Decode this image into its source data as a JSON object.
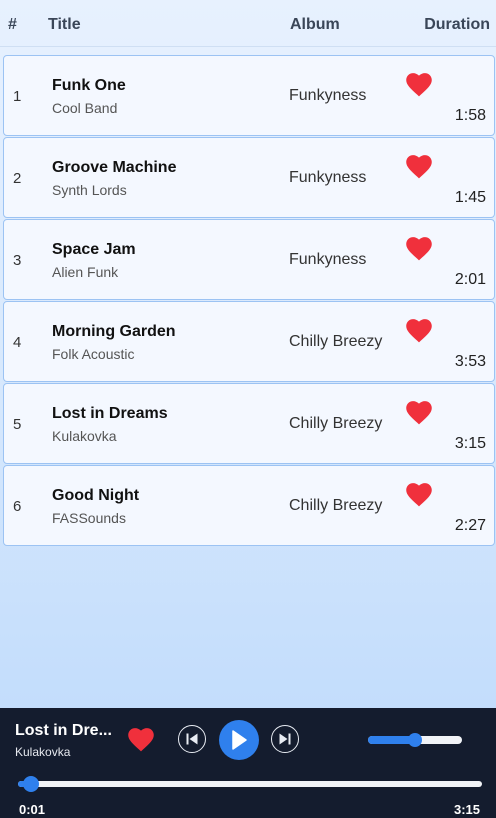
{
  "header": {
    "num": "#",
    "title": "Title",
    "album": "Album",
    "duration": "Duration"
  },
  "tracks": [
    {
      "num": "1",
      "title": "Funk One",
      "artist": "Cool Band",
      "album": "Funkyness",
      "duration": "1:58",
      "liked": true
    },
    {
      "num": "2",
      "title": "Groove Machine",
      "artist": "Synth Lords",
      "album": "Funkyness",
      "duration": "1:45",
      "liked": true
    },
    {
      "num": "3",
      "title": "Space Jam",
      "artist": "Alien Funk",
      "album": "Funkyness",
      "duration": "2:01",
      "liked": true
    },
    {
      "num": "4",
      "title": "Morning Garden",
      "artist": "Folk Acoustic",
      "album": "Chilly Breezy",
      "duration": "3:53",
      "liked": true
    },
    {
      "num": "5",
      "title": "Lost in Dreams",
      "artist": "Kulakovka",
      "album": "Chilly Breezy",
      "duration": "3:15",
      "liked": true
    },
    {
      "num": "6",
      "title": "Good Night",
      "artist": "FASSounds",
      "album": "Chilly Breezy",
      "duration": "2:27",
      "liked": true
    }
  ],
  "player": {
    "title": "Lost in Dre...",
    "artist": "Kulakovka",
    "liked": true,
    "current_time": "0:01",
    "total_time": "3:15",
    "progress_fraction": 0.02,
    "volume_fraction": 0.5,
    "icons": {
      "prev": "skip-previous-icon",
      "play": "play-icon",
      "next": "skip-next-icon",
      "like": "heart-icon"
    }
  },
  "colors": {
    "accent": "#2f80ed",
    "heart": "#f0303c",
    "player_bg": "#141c2e",
    "row_border": "#9cc3f3"
  }
}
